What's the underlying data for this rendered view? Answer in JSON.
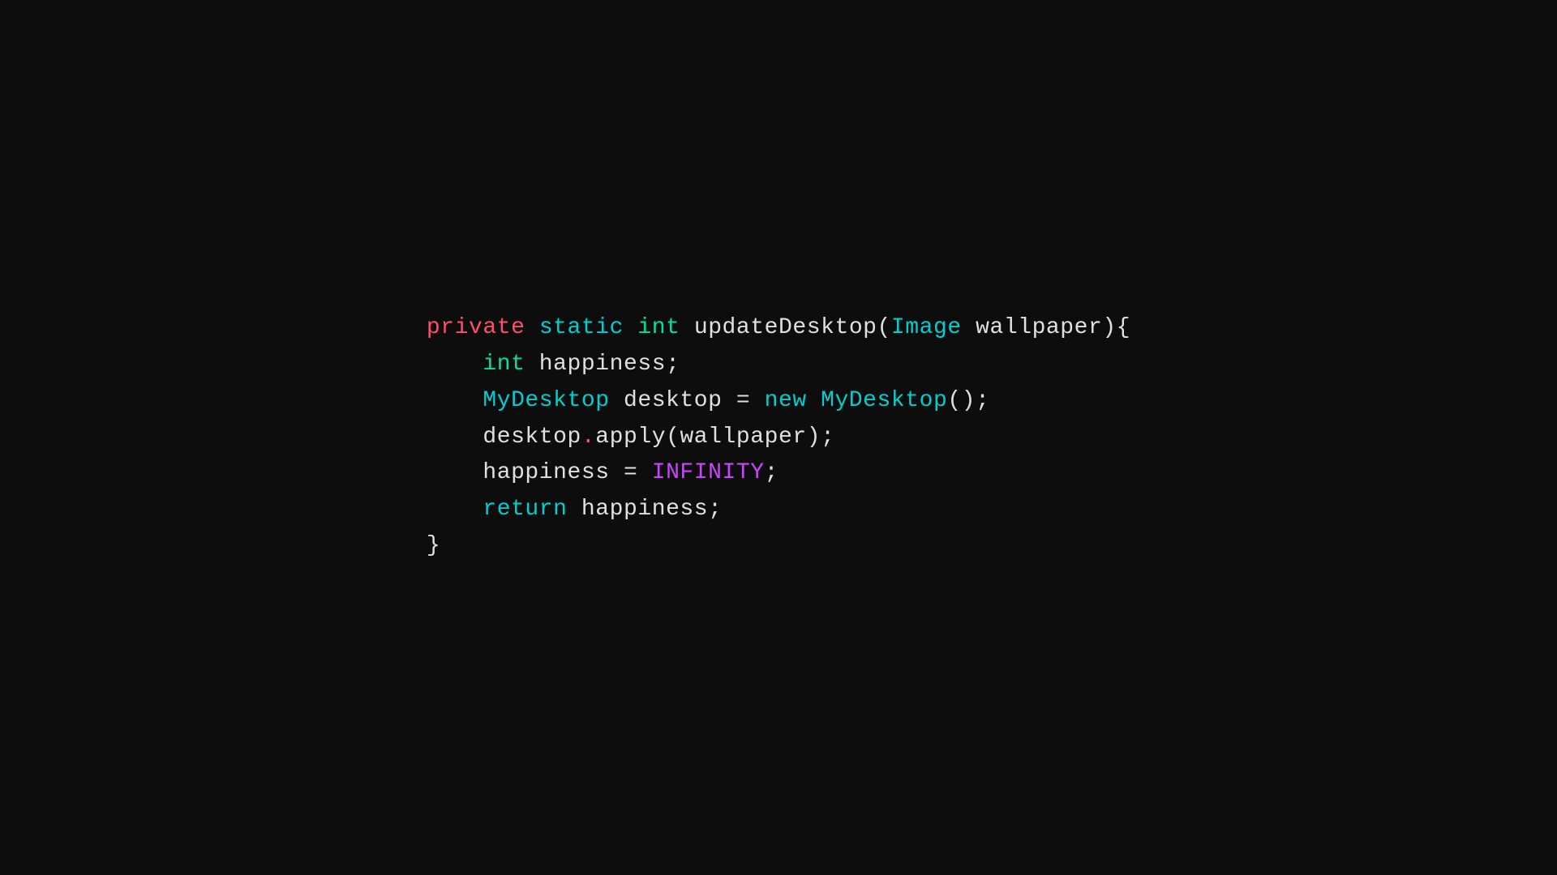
{
  "code": {
    "lines": [
      {
        "id": "line1",
        "parts": [
          {
            "text": "private",
            "class": "keyword-private"
          },
          {
            "text": " ",
            "class": "default-text"
          },
          {
            "text": "static",
            "class": "keyword-static"
          },
          {
            "text": " ",
            "class": "default-text"
          },
          {
            "text": "int",
            "class": "keyword-int"
          },
          {
            "text": " updateDesktop(",
            "class": "default-text"
          },
          {
            "text": "Image",
            "class": "class-name"
          },
          {
            "text": " wallpaper){",
            "class": "default-text"
          }
        ]
      },
      {
        "id": "line2",
        "parts": [
          {
            "text": "    ",
            "class": "default-text"
          },
          {
            "text": "int",
            "class": "keyword-int2"
          },
          {
            "text": " happiness;",
            "class": "default-text"
          }
        ]
      },
      {
        "id": "line3",
        "parts": [
          {
            "text": "    ",
            "class": "default-text"
          },
          {
            "text": "MyDesktop",
            "class": "class-name"
          },
          {
            "text": " desktop = ",
            "class": "default-text"
          },
          {
            "text": "new",
            "class": "keyword-new"
          },
          {
            "text": " ",
            "class": "default-text"
          },
          {
            "text": "MyDesktop",
            "class": "class-name"
          },
          {
            "text": "();",
            "class": "default-text"
          }
        ]
      },
      {
        "id": "line4",
        "parts": [
          {
            "text": "    desktop",
            "class": "default-text"
          },
          {
            "text": ".",
            "class": "dot"
          },
          {
            "text": "apply(wallpaper);",
            "class": "default-text"
          }
        ]
      },
      {
        "id": "line5",
        "parts": [
          {
            "text": "    happiness = ",
            "class": "default-text"
          },
          {
            "text": "INFINITY",
            "class": "constant"
          },
          {
            "text": ";",
            "class": "default-text"
          }
        ]
      },
      {
        "id": "line6",
        "parts": [
          {
            "text": "    ",
            "class": "default-text"
          },
          {
            "text": "return",
            "class": "keyword-return"
          },
          {
            "text": " happiness;",
            "class": "default-text"
          }
        ]
      },
      {
        "id": "line7",
        "parts": [
          {
            "text": "}",
            "class": "default-text"
          }
        ]
      }
    ]
  }
}
